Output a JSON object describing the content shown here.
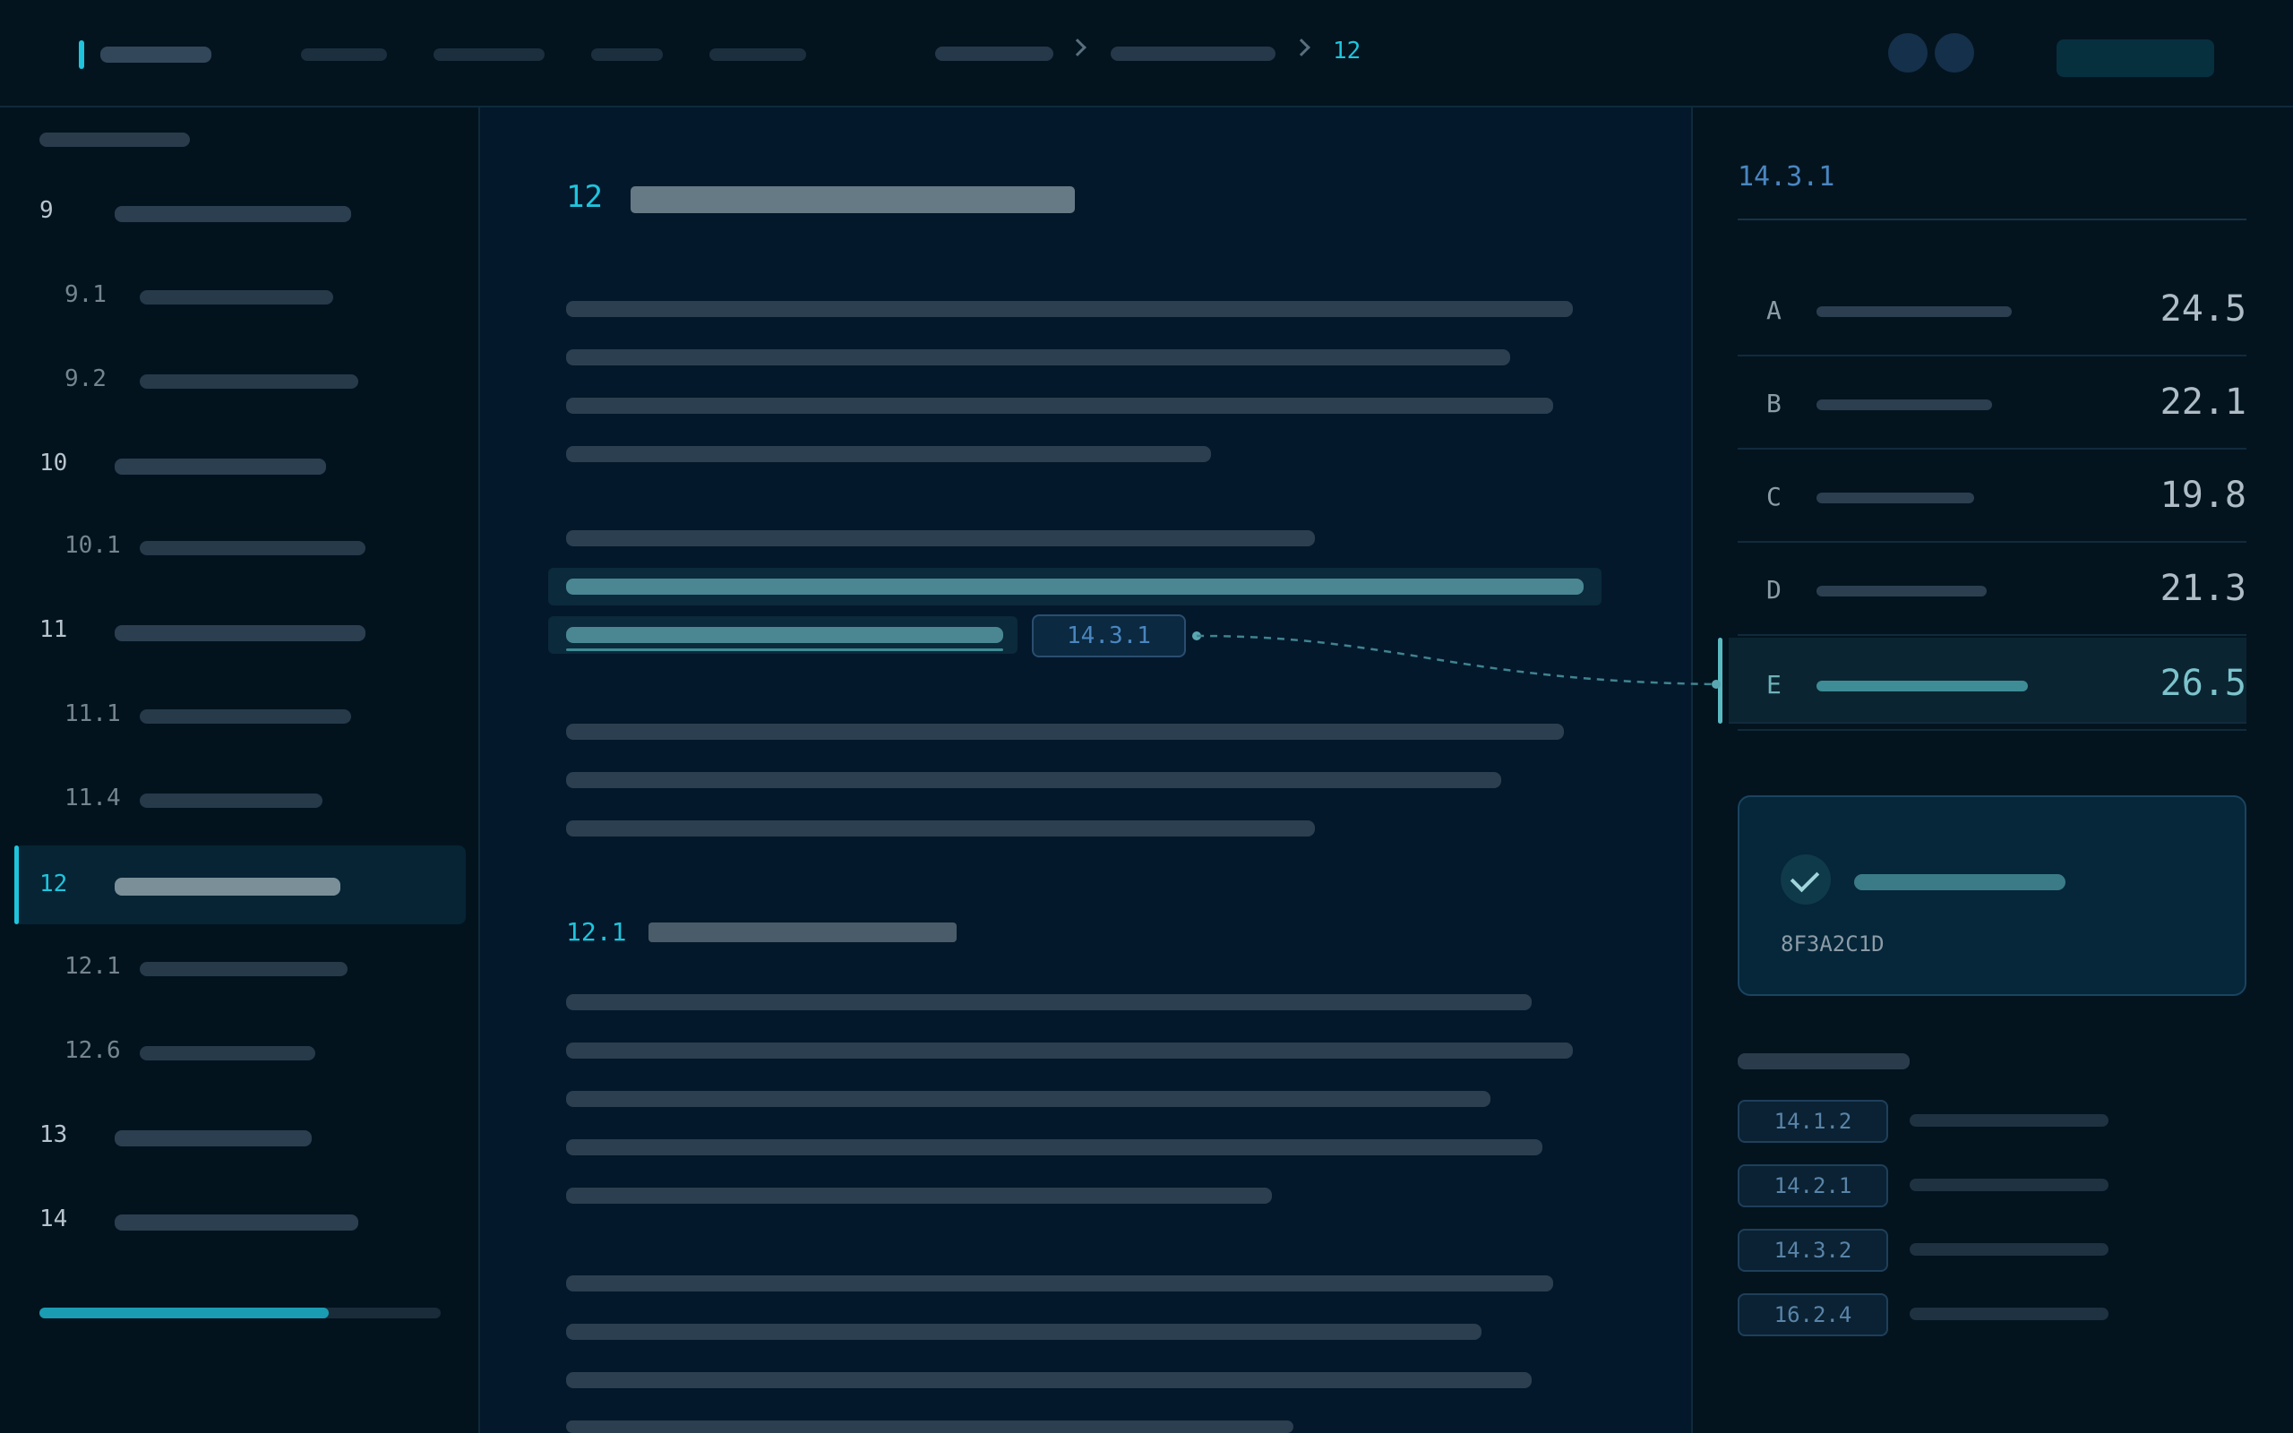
{
  "breadcrumb": {
    "current": "12"
  },
  "sidebar": {
    "items": [
      {
        "num": "9",
        "level": 1
      },
      {
        "num": "9.1",
        "level": 2
      },
      {
        "num": "9.2",
        "level": 2
      },
      {
        "num": "10",
        "level": 1
      },
      {
        "num": "10.1",
        "level": 2
      },
      {
        "num": "11",
        "level": 1
      },
      {
        "num": "11.1",
        "level": 2
      },
      {
        "num": "11.4",
        "level": 2
      },
      {
        "num": "12",
        "level": 1,
        "active": true
      },
      {
        "num": "12.1",
        "level": 2
      },
      {
        "num": "12.6",
        "level": 2
      },
      {
        "num": "13",
        "level": 1
      },
      {
        "num": "14",
        "level": 1
      }
    ],
    "progress_fraction": 0.72
  },
  "main": {
    "section_number": "12",
    "subsection_number": "12.1",
    "inline_reference": "14.3.1"
  },
  "right_panel": {
    "title": "14.3.1",
    "rows": [
      {
        "letter": "A",
        "value": "24.5"
      },
      {
        "letter": "B",
        "value": "22.1"
      },
      {
        "letter": "C",
        "value": "19.8"
      },
      {
        "letter": "D",
        "value": "21.3"
      },
      {
        "letter": "E",
        "value": "26.5",
        "active": true
      }
    ],
    "verification": {
      "icon": "check-icon",
      "hash": "8F3A2C1D"
    },
    "related": [
      "14.1.2",
      "14.2.1",
      "14.3.2",
      "16.2.4"
    ]
  },
  "colors": {
    "accent": "#1fc4dc",
    "background": "#04182b",
    "highlight": "#4a8793"
  }
}
